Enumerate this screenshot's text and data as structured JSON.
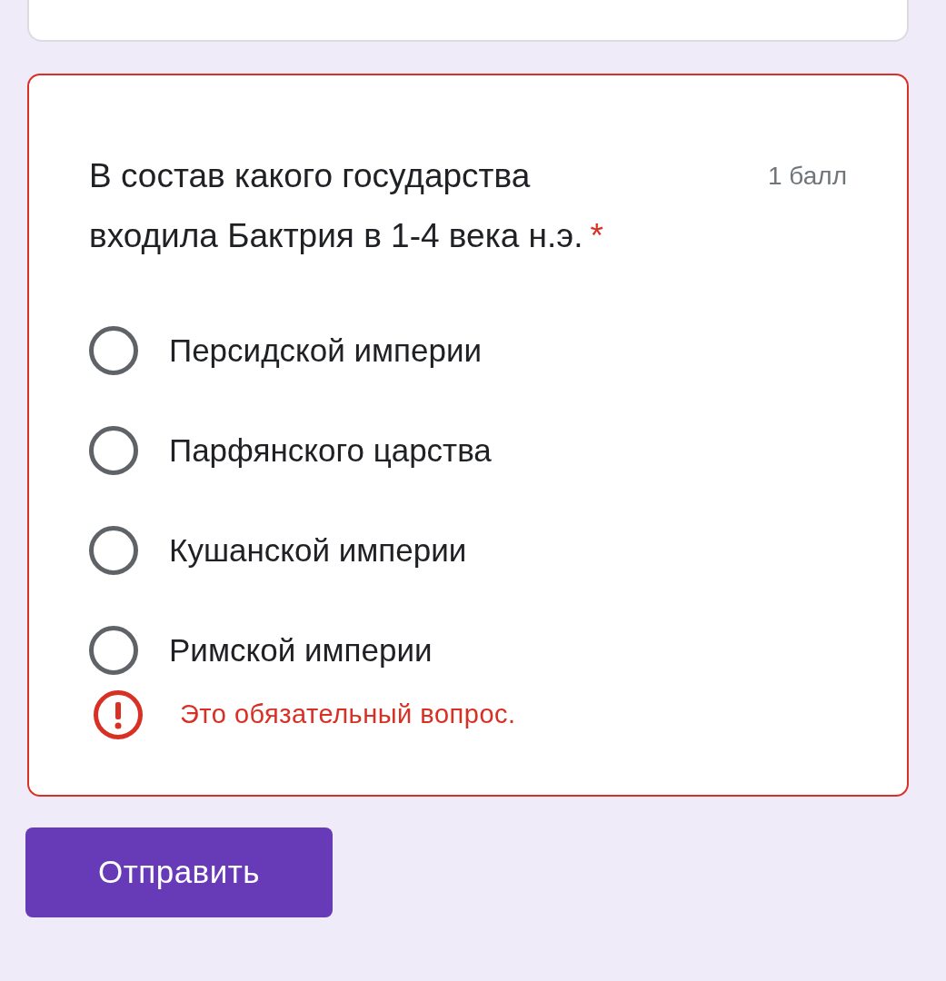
{
  "question": {
    "text": "В состав какого государства входила Бактрия в 1-4 века н.э.",
    "required_mark": "*",
    "points": "1 балл",
    "has_error": true,
    "options": [
      {
        "label": "Персидской империи",
        "selected": false
      },
      {
        "label": "Парфянского царства",
        "selected": false
      },
      {
        "label": "Кушанской империи",
        "selected": false
      },
      {
        "label": "Римской империи",
        "selected": false
      }
    ],
    "error": "Это обязательный вопрос."
  },
  "submit_button": "Отправить"
}
